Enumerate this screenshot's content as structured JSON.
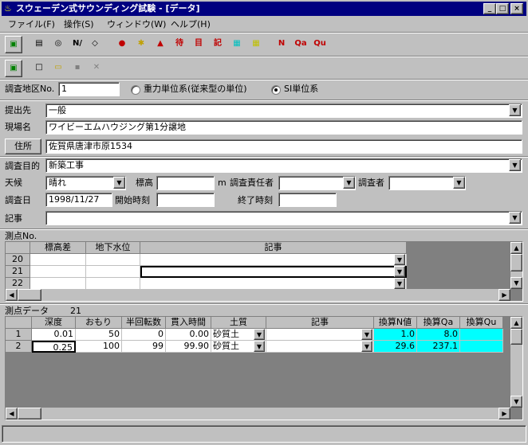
{
  "window": {
    "title": "スウェーデン式サウンディング試験 - [データ]",
    "min": "_",
    "max": "□",
    "close": "×"
  },
  "menu": [
    "ファイル(F)",
    "操作(S)",
    "ウィンドウ(W)",
    "ヘルプ(H)"
  ],
  "toolbar1": [
    {
      "name": "app-icon",
      "glyph": "▣"
    },
    {
      "name": "list-icon",
      "glyph": "▤"
    },
    {
      "name": "binoculars-icon",
      "glyph": "◎"
    },
    {
      "name": "edit-icon",
      "glyph": "N/"
    },
    {
      "name": "preview-icon",
      "glyph": "◇"
    },
    {
      "name": "bull-icon",
      "glyph": "●"
    },
    {
      "name": "gear-icon",
      "glyph": "✱"
    },
    {
      "name": "hill-icon",
      "glyph": "▲"
    },
    {
      "name": "wait-icon",
      "glyph": "待"
    },
    {
      "name": "eye-icon",
      "glyph": "目"
    },
    {
      "name": "record-icon",
      "glyph": "記"
    },
    {
      "name": "grid-cyan-icon",
      "glyph": "▦"
    },
    {
      "name": "grid-yellow-icon",
      "glyph": "▦"
    },
    {
      "name": "n-value-icon",
      "glyph": "N"
    },
    {
      "name": "qa-icon",
      "glyph": "Qa"
    },
    {
      "name": "qu-icon",
      "glyph": "Qu"
    }
  ],
  "toolbar2": [
    {
      "name": "exit-icon",
      "glyph": "▣"
    },
    {
      "name": "new-file-icon",
      "glyph": "□"
    },
    {
      "name": "open-folder-icon",
      "glyph": "▭"
    },
    {
      "name": "save-icon",
      "glyph": "▪"
    },
    {
      "name": "delete-icon",
      "glyph": "✕"
    }
  ],
  "survey": {
    "area_label": "調査地区No.",
    "area_value": "1",
    "radio_gravity": "重力単位系(従来型の単位)",
    "radio_si": "SI単位系"
  },
  "form": {
    "submit_label": "提出先",
    "submit_value": "一般",
    "site_label": "現場名",
    "site_value": "ワイビーエムハウジング第1分譲地",
    "address_button": "住所",
    "address_value": "佐賀県唐津市原1534",
    "purpose_label": "調査目的",
    "purpose_value": "新築工事",
    "weather_label": "天候",
    "weather_value": "晴れ",
    "elev_label": "標高",
    "elev_value": "",
    "elev_unit": "m",
    "manager_label": "調査責任者",
    "manager_value": "",
    "surveyor_label": "調査者",
    "surveyor_value": "",
    "date_label": "調査日",
    "date_value": "1998/11/27",
    "start_label": "開始時刻",
    "start_value": "",
    "end_label": "終了時刻",
    "end_value": "",
    "notes_label": "記事",
    "notes_value": ""
  },
  "points": {
    "title": "測点No.",
    "headers": [
      "標高差",
      "地下水位",
      "記事"
    ],
    "rows": [
      {
        "no": "20",
        "elev": "",
        "water": "",
        "note": ""
      },
      {
        "no": "21",
        "elev": "",
        "water": "",
        "note": ""
      },
      {
        "no": "22",
        "elev": "",
        "water": "",
        "note": ""
      }
    ]
  },
  "pointdata": {
    "title": "測点データ",
    "count": "21",
    "headers": [
      "深度",
      "おもり",
      "半回転数",
      "貫入時間",
      "土質",
      "記事",
      "換算N値",
      "換算Qa",
      "換算Qu"
    ],
    "rows": [
      {
        "no": "1",
        "depth": "0.01",
        "weight": "50",
        "turns": "0",
        "time": "0.00",
        "soil": "砂質土",
        "note": "",
        "n": "1.0",
        "qa": "8.0",
        "qu": ""
      },
      {
        "no": "2",
        "depth": "0.25",
        "weight": "100",
        "turns": "99",
        "time": "99.90",
        "soil": "砂質土",
        "note": "",
        "n": "29.6",
        "qa": "237.1",
        "qu": ""
      }
    ]
  },
  "icons": {
    "dropdown": "▼",
    "up": "▲",
    "down": "▼",
    "left": "◀",
    "right": "▶"
  }
}
